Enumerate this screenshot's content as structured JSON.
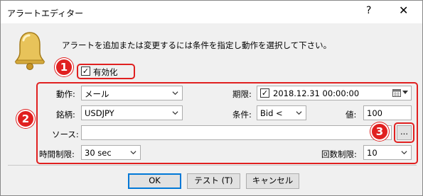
{
  "window": {
    "title": "アラートエディター",
    "help_label": "?",
    "close_label": "✕"
  },
  "description": "アラートを追加または変更するには条件を指定し動作を選択して下さい。",
  "enable": {
    "label": "有効化",
    "checked": true
  },
  "badges": [
    "1",
    "2",
    "3"
  ],
  "form": {
    "action_label": "動作:",
    "action_value": "メール",
    "expiry_label": "期限:",
    "expiry_checked": true,
    "expiry_value": "2018.12.31 00:00:00",
    "symbol_label": "銘柄:",
    "symbol_value": "USDJPY",
    "condition_label": "条件:",
    "condition_value": "Bid <",
    "value_label": "値:",
    "value_value": "100",
    "source_label": "ソース:",
    "source_value": "",
    "browse_label": "...",
    "interval_label": "時間制限:",
    "interval_value": "30 sec",
    "count_label": "回数制限:",
    "count_value": "10"
  },
  "buttons": {
    "ok": "OK",
    "test": "テスト (T)",
    "cancel": "キャンセル"
  },
  "colors": {
    "highlight": "#e02020",
    "default_button_border": "#0078d7"
  }
}
